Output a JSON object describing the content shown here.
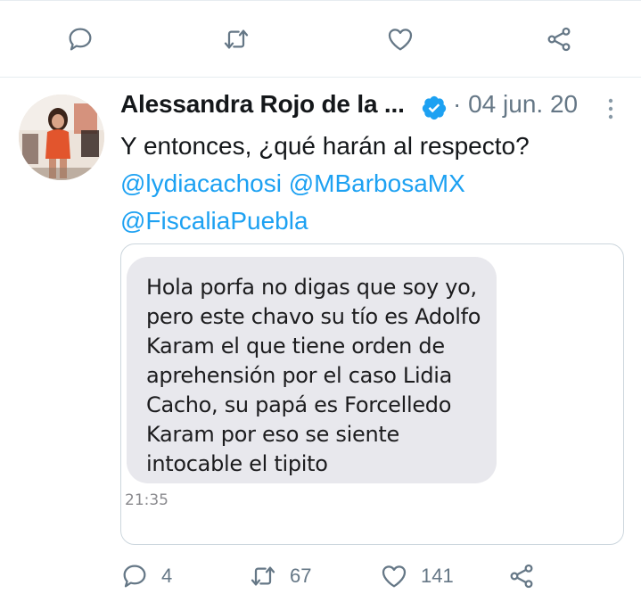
{
  "previous_tweet_actions": {
    "reply_icon": "reply-icon",
    "retweet_icon": "retweet-icon",
    "like_icon": "heart-icon",
    "share_icon": "share-icon"
  },
  "tweet": {
    "author_name": "Alessandra Rojo de la ...",
    "verified_icon": "verified-badge-icon",
    "separator": "·",
    "date": "04 jun. 20",
    "text_line_1": "Y entonces, ¿qué harán al respecto?",
    "mentions": [
      "@lydiacachosi",
      "@MBarbosaMX",
      "@FiscaliaPuebla"
    ],
    "image": {
      "message_lines": [
        "Hola porfa no digas que soy yo,",
        "pero este chavo su tío es Adolfo",
        "Karam el que tiene orden de",
        "aprehensión por el caso Lidia",
        "Cacho, su papá es Forcelledo",
        "Karam por eso se siente",
        "intocable el tipito"
      ],
      "time": "21:35"
    },
    "reply_count": "4",
    "retweet_count": "67",
    "like_count": "141"
  },
  "colors": {
    "mention": "#1da1f2",
    "secondary_text": "#657786",
    "icon": "#657786",
    "verified": "#1da1f2",
    "bubble": "#e8e8ed"
  }
}
